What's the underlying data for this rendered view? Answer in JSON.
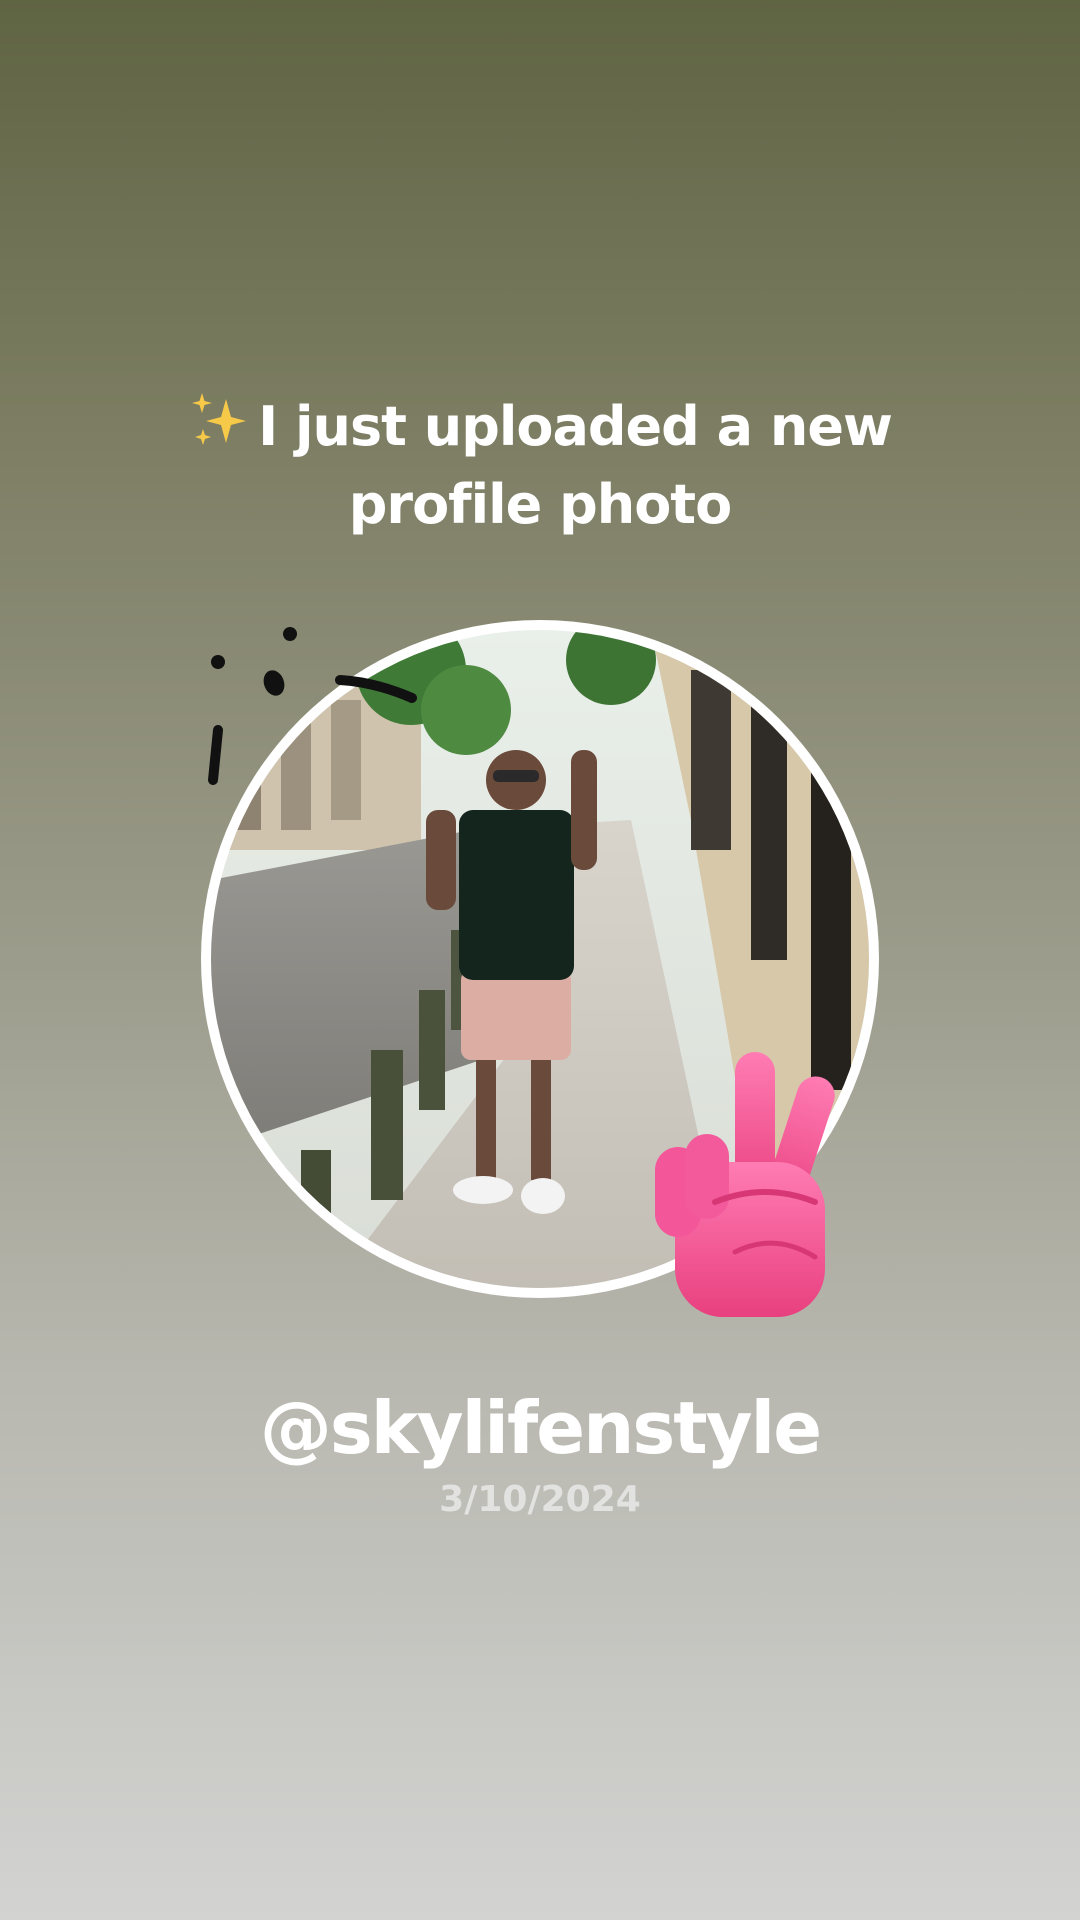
{
  "story": {
    "headline": {
      "line1": "I just uploaded a new",
      "line2": "profile photo",
      "icon": "sparkles-icon"
    },
    "profile_photo": {
      "description_icon": "profile-photo"
    },
    "username": "@skylifenstyle",
    "date": "3/10/2024",
    "stickers": [
      "doodle-sticker",
      "peace-hand-icon"
    ],
    "colors": {
      "accent_sticker": "#f2609a",
      "text": "#ffffff",
      "date_text": "#e2e2e0",
      "sparkle": "#f7c948"
    }
  }
}
